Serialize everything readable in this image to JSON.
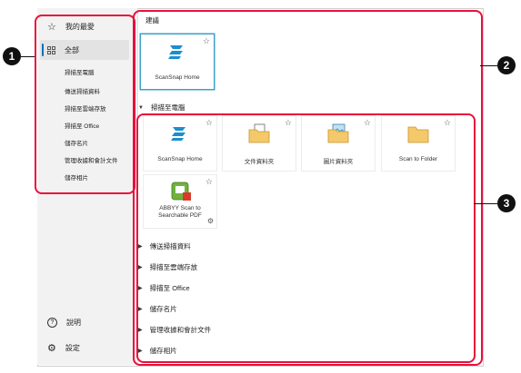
{
  "sidebar": {
    "favorites": "我的最愛",
    "all": "全部",
    "items": [
      "掃描至電腦",
      "傳送掃描資料",
      "掃描至雲端存放",
      "掃描至 Office",
      "儲存名片",
      "管理收據和會計文件",
      "儲存相片"
    ],
    "help": "說明",
    "settings": "設定"
  },
  "suggestions": {
    "title": "建議",
    "tile": "ScanSnap Home"
  },
  "expanded_group": {
    "title": "掃描至電腦",
    "tiles": [
      "ScanSnap Home",
      "文件資料夾",
      "圖片資料夾",
      "Scan to Folder"
    ],
    "abbyy": [
      "ABBYY Scan to",
      "Searchable PDF"
    ]
  },
  "collapsed_groups": [
    "傳送掃描資料",
    "掃描至雲端存放",
    "掃描至 Office",
    "儲存名片",
    "管理收據和會計文件",
    "儲存相片"
  ],
  "callouts": [
    "1",
    "2",
    "3"
  ],
  "colors": {
    "accent": "#0b6fb8",
    "highlight": "#e8103c",
    "scansnap": "#1a8fd0"
  }
}
